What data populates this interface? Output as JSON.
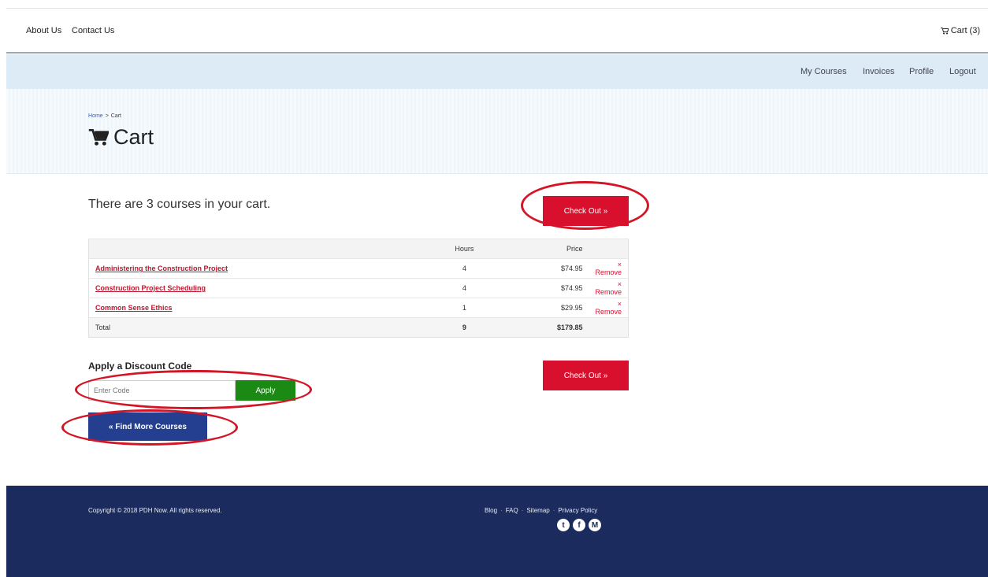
{
  "topnav": {
    "about": "About Us",
    "contact": "Contact Us",
    "cart_label": "Cart (3)"
  },
  "subnav": {
    "my_courses": "My Courses",
    "invoices": "Invoices",
    "profile": "Profile",
    "logout": "Logout"
  },
  "breadcrumb": {
    "home": "Home",
    "separator": ">",
    "current": "Cart"
  },
  "page": {
    "title": "Cart",
    "cart_count_text": "There are 3 courses in your cart.",
    "checkout_label": "Check Out »"
  },
  "table": {
    "headers": {
      "course": "",
      "hours": "Hours",
      "price": "Price",
      "action": ""
    },
    "rows": [
      {
        "course": "Administering the Construction Project",
        "hours": "4",
        "price": "$74.95",
        "action": "× Remove"
      },
      {
        "course": "Construction Project Scheduling",
        "hours": "4",
        "price": "$74.95",
        "action": "× Remove"
      },
      {
        "course": "Common Sense Ethics",
        "hours": "1",
        "price": "$29.95",
        "action": "× Remove"
      }
    ],
    "total": {
      "label": "Total",
      "hours": "9",
      "price": "$179.85"
    }
  },
  "discount": {
    "heading": "Apply a Discount Code",
    "placeholder": "Enter Code",
    "apply_label": "Apply"
  },
  "find_more_label": "« Find More Courses",
  "footer": {
    "copyright": "Copyright © 2018 PDH Now. All rights reserved.",
    "links": {
      "blog": "Blog",
      "faq": "FAQ",
      "sitemap": "Sitemap",
      "privacy": "Privacy Policy",
      "separator": "·"
    },
    "social": {
      "twitter": "t",
      "facebook": "f",
      "medium": "M"
    }
  },
  "colors": {
    "accent_red": "#d8102e",
    "apply_green": "#1a8a14",
    "find_blue": "#243f8f",
    "footer_navy": "#1b2b5e",
    "subnav_blue": "#dcebf6"
  }
}
